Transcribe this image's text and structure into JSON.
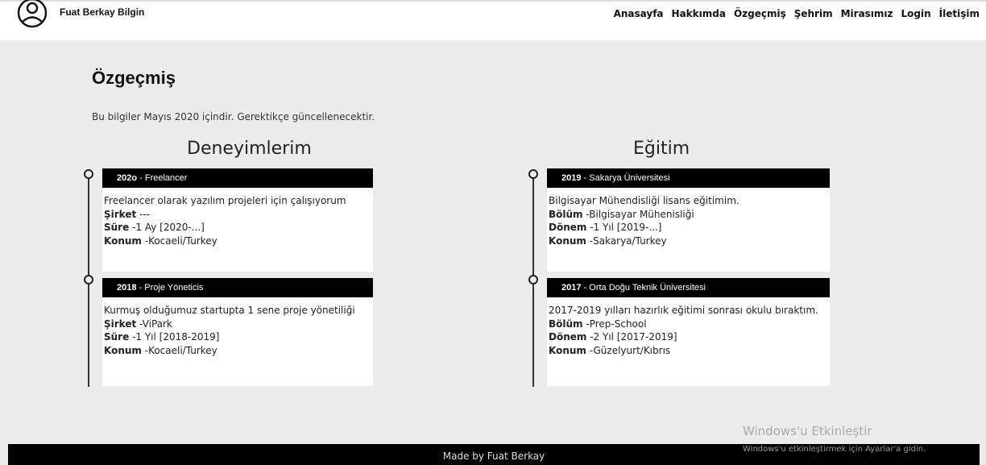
{
  "header": {
    "brand": "Fuat Berkay Bilgin",
    "logo_icon": "user-circle-icon",
    "nav": [
      "Anasayfa",
      "Hakkımda",
      "Özgeçmiş",
      "Şehrim",
      "Mirasımız",
      "Login",
      "İletişim"
    ]
  },
  "page": {
    "title": "Özgeçmiş",
    "note": "Bu bilgiler Mayıs 2020 içindir. Gerektikçe güncellenecektir."
  },
  "experience": {
    "heading": "Deneyimlerim",
    "items": [
      {
        "year": "202o",
        "title": " - Freelancer",
        "description": "Freelancer olarak yazılım projeleri için çalışıyorum",
        "company_label": "Şirket",
        "company": " ---",
        "duration_label": "Süre",
        "duration": " -1 Ay [2020-...]",
        "location_label": "Konum",
        "location": " -Kocaeli/Turkey"
      },
      {
        "year": "2018",
        "title": " - Proje Yöneticis",
        "description": "Kurmuş olduğumuz startupta 1 sene proje yönetiliği",
        "company_label": "Şirket",
        "company": " -ViPark",
        "duration_label": "Süre",
        "duration": " -1 Yıl [2018-2019]",
        "location_label": "Konum",
        "location": " -Kocaeli/Turkey"
      }
    ]
  },
  "education": {
    "heading": "Eğitim",
    "items": [
      {
        "year": "2019",
        "title": " - Sakarya Üniversitesi",
        "description": "Bilgisayar Mühendisliği lisans eğitimim.",
        "dept_label": "Bölüm",
        "dept": " -Bilgisayar Mühenisliği",
        "period_label": "Dönem",
        "period": " -1 Yıl [2019-...]",
        "location_label": "Konum",
        "location": " -Sakarya/Turkey"
      },
      {
        "year": "2017",
        "title": " - Orta Doğu Teknik Üniversitesi",
        "description": "2017-2019 yılları hazırlık eğitimi sonrası okulu bıraktım.",
        "dept_label": "Bölüm",
        "dept": " -Prep-School",
        "period_label": "Dönem",
        "period": " -2 Yıl [2017-2019]",
        "location_label": "Konum",
        "location": " -Güzelyurt/Kıbrıs"
      }
    ]
  },
  "watermark": {
    "title": "Windows'u Etkinleştir",
    "subtitle": "Windows'u etkinleştirmek için Ayarlar'a gidin."
  },
  "footer": {
    "text": "Made by Fuat Berkay"
  }
}
